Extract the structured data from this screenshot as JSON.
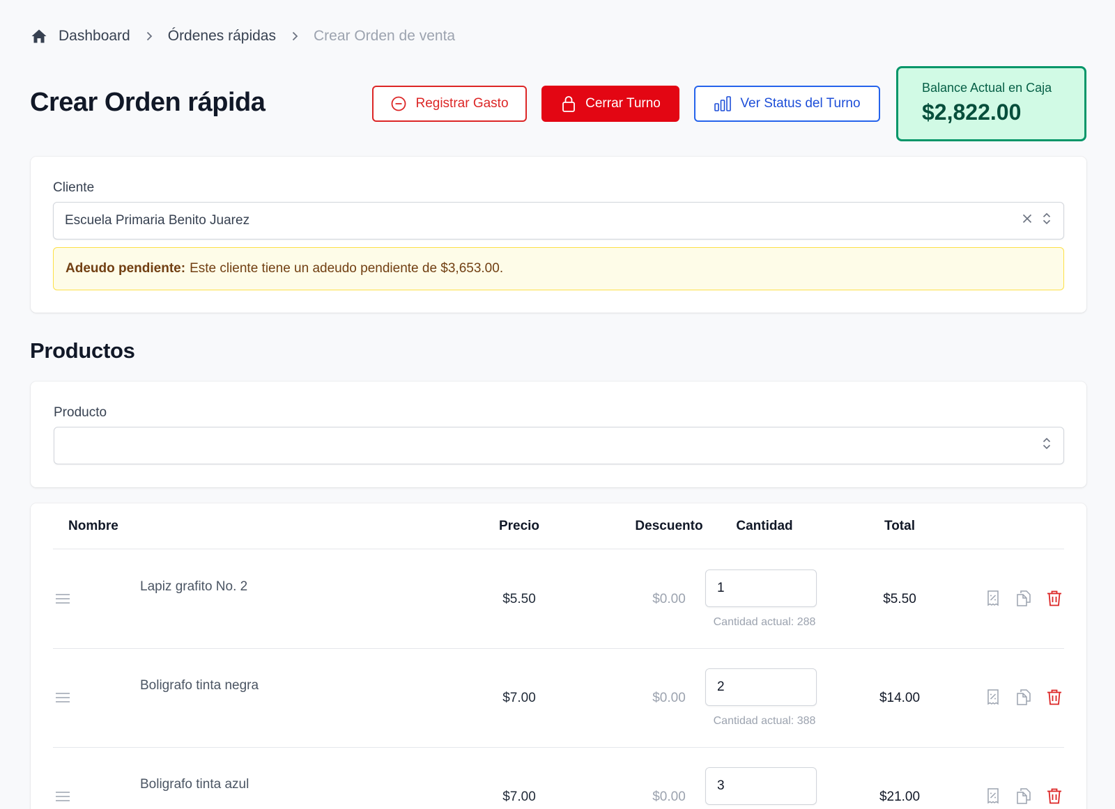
{
  "breadcrumb": {
    "items": [
      "Dashboard",
      "Órdenes rápidas",
      "Crear Orden de venta"
    ]
  },
  "header": {
    "title": "Crear Orden rápida",
    "btn_gasto": "Registrar Gasto",
    "btn_cerrar": "Cerrar Turno",
    "btn_status": "Ver Status del Turno"
  },
  "balance": {
    "label": "Balance Actual en Caja",
    "value": "$2,822.00"
  },
  "cliente": {
    "label": "Cliente",
    "value": "Escuela Primaria Benito Juarez",
    "alert_strong": "Adeudo pendiente:",
    "alert_text": "Este cliente tiene un adeudo pendiente de $3,653.00."
  },
  "productos": {
    "section_title": "Productos",
    "field_label": "Producto",
    "field_value": ""
  },
  "table": {
    "headers": {
      "nombre": "Nombre",
      "precio": "Precio",
      "descuento": "Descuento",
      "cantidad": "Cantidad",
      "total": "Total"
    },
    "rows": [
      {
        "name": "Lapiz grafito No. 2",
        "price": "$5.50",
        "discount": "$0.00",
        "qty": "1",
        "stock": "Cantidad actual: 288",
        "total": "$5.50"
      },
      {
        "name": "Boligrafo tinta negra",
        "price": "$7.00",
        "discount": "$0.00",
        "qty": "2",
        "stock": "Cantidad actual: 388",
        "total": "$14.00"
      },
      {
        "name": "Boligrafo tinta azul",
        "price": "$7.00",
        "discount": "$0.00",
        "qty": "3",
        "stock": "",
        "total": "$21.00"
      }
    ]
  },
  "colors": {
    "danger": "#e30613",
    "primary": "#2563eb",
    "success_bg": "#d1fae5",
    "success_border": "#059669",
    "warning_bg": "#fefce8",
    "warning_border": "#fde047"
  }
}
